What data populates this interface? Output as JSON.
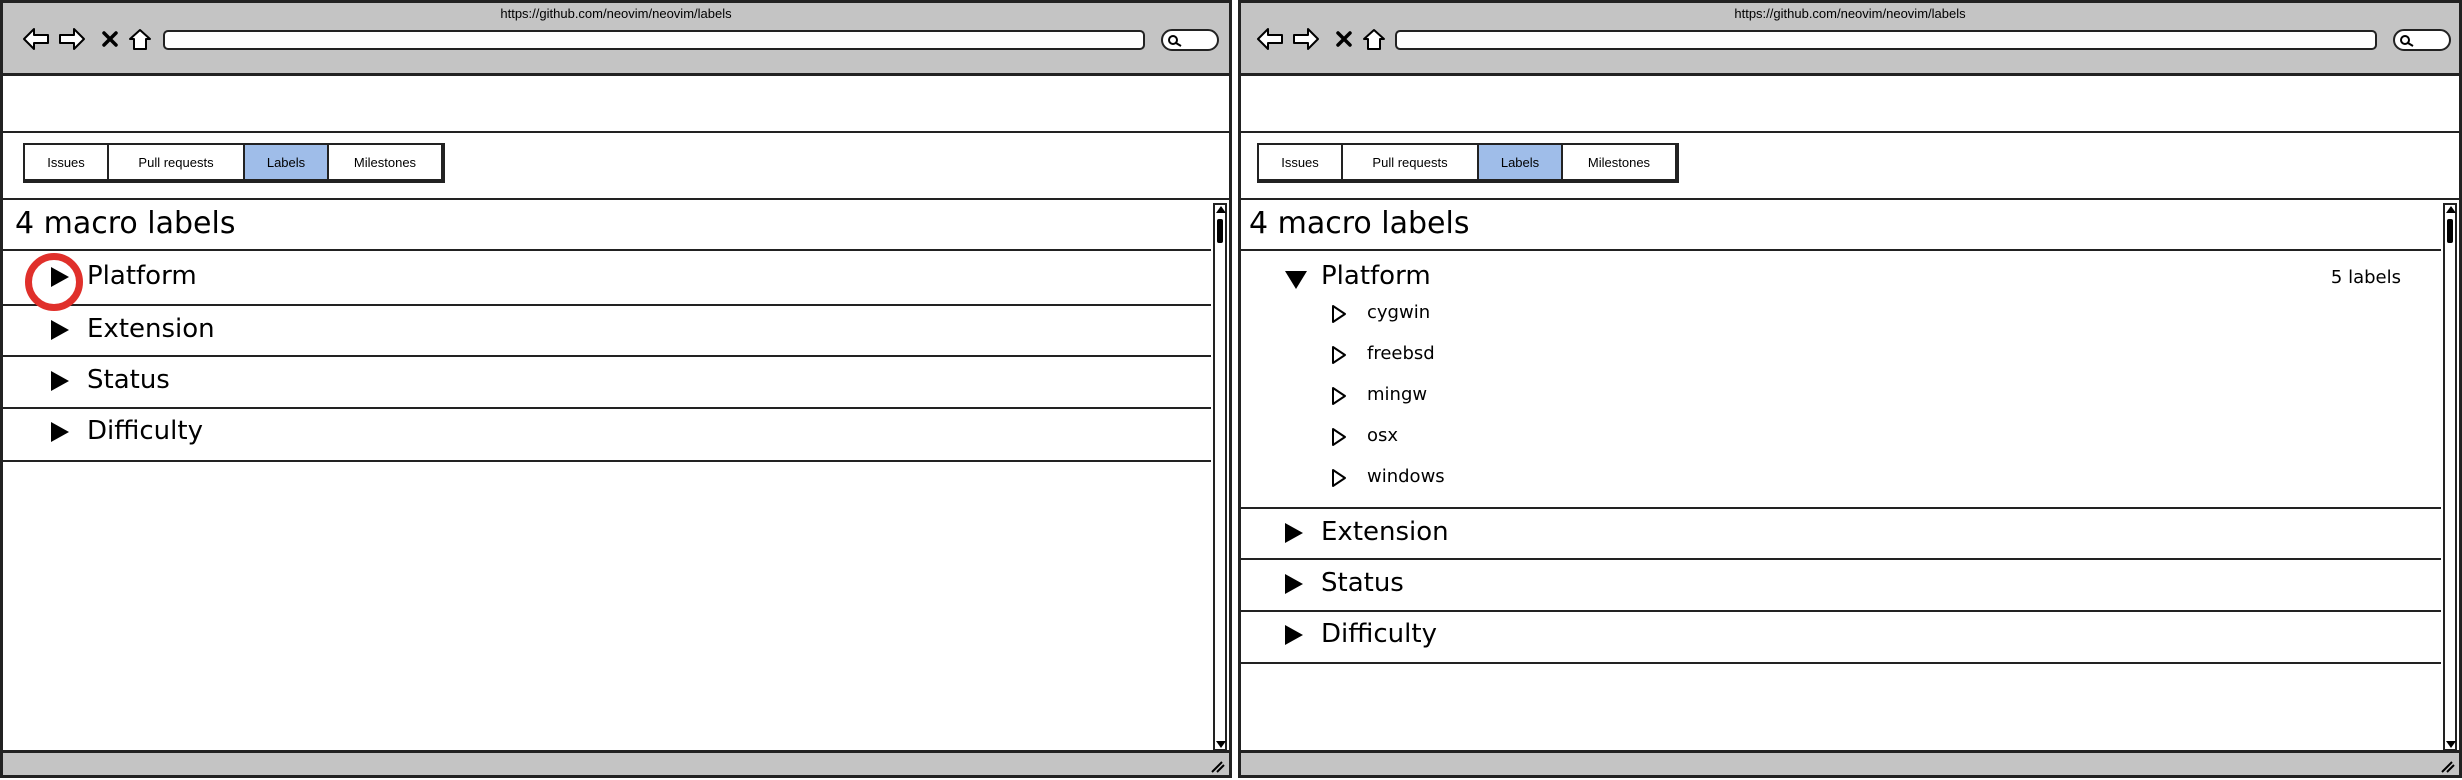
{
  "left": {
    "url": "https://github.com/neovim/neovim/labels",
    "tabs": [
      {
        "label": "Issues",
        "active": false
      },
      {
        "label": "Pull requests",
        "active": false
      },
      {
        "label": "Labels",
        "active": true
      },
      {
        "label": "Milestones",
        "active": false
      }
    ],
    "heading": "4 macro labels",
    "groups": [
      {
        "label": "Platform",
        "expanded": false
      },
      {
        "label": "Extension",
        "expanded": false
      },
      {
        "label": "Status",
        "expanded": false
      },
      {
        "label": "Difficulty",
        "expanded": false
      }
    ]
  },
  "right": {
    "url": "https://github.com/neovim/neovim/labels",
    "tabs": [
      {
        "label": "Issues",
        "active": false
      },
      {
        "label": "Pull requests",
        "active": false
      },
      {
        "label": "Labels",
        "active": true
      },
      {
        "label": "Milestones",
        "active": false
      }
    ],
    "heading": "4 macro labels",
    "groups": [
      {
        "label": "Platform",
        "expanded": true,
        "count": "5 labels",
        "children": [
          "cygwin",
          "freebsd",
          "mingw",
          "osx",
          "windows"
        ]
      },
      {
        "label": "Extension",
        "expanded": false
      },
      {
        "label": "Status",
        "expanded": false
      },
      {
        "label": "Difficulty",
        "expanded": false
      }
    ]
  },
  "colors": {
    "chrome": "#c4c4c4",
    "active_tab": "#9fbde9",
    "highlight_circle": "#e0302b"
  }
}
